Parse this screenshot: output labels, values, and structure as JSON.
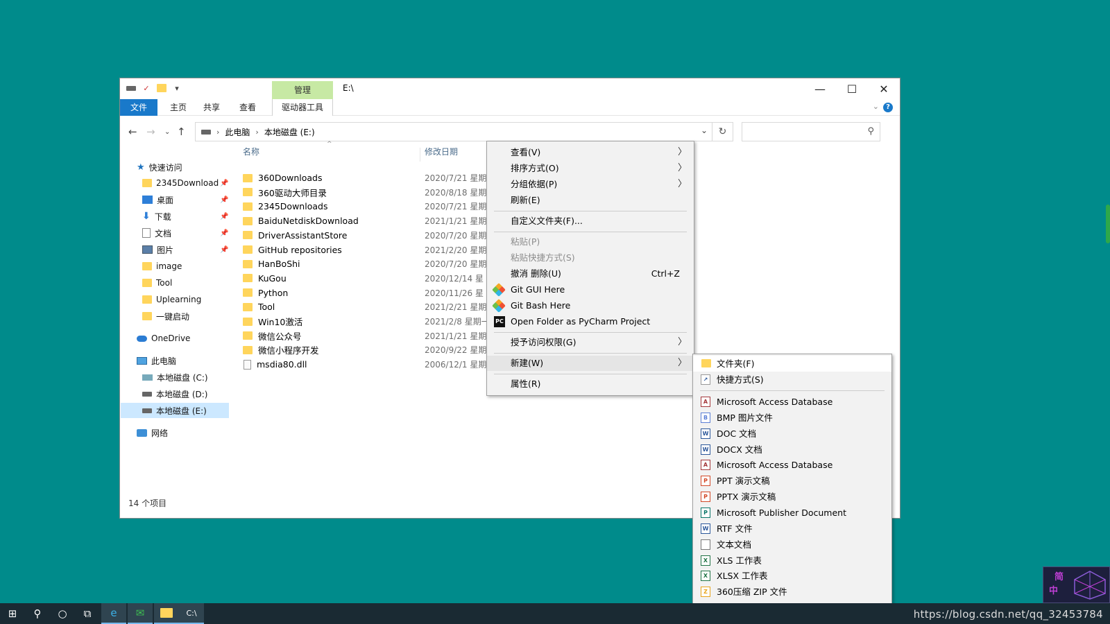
{
  "window": {
    "title": "E:\\",
    "manage_tab": "管理",
    "ribbon_tabs": [
      "文件",
      "主页",
      "共享",
      "查看",
      "驱动器工具"
    ]
  },
  "address": {
    "crumbs": [
      "此电脑",
      "本地磁盘 (E:)"
    ]
  },
  "nav": {
    "quick_access": "快速访问",
    "pinned": [
      "2345Download",
      "桌面",
      "下载",
      "文档",
      "图片"
    ],
    "folders": [
      "image",
      "Tool",
      "Uplearning",
      "一键启动"
    ],
    "onedrive": "OneDrive",
    "this_pc": "此电脑",
    "drives": [
      "本地磁盘 (C:)",
      "本地磁盘 (D:)",
      "本地磁盘 (E:)"
    ],
    "network": "网络"
  },
  "columns": {
    "name": "名称",
    "modified": "修改日期"
  },
  "files": [
    {
      "name": "360Downloads",
      "date": "2020/7/21 星期"
    },
    {
      "name": "360驱动大师目录",
      "date": "2020/8/18 星期"
    },
    {
      "name": "2345Downloads",
      "date": "2020/7/21 星期"
    },
    {
      "name": "BaiduNetdiskDownload",
      "date": "2021/1/21 星期"
    },
    {
      "name": "DriverAssistantStore",
      "date": "2020/7/20 星期"
    },
    {
      "name": "GitHub repositories",
      "date": "2021/2/20 星期"
    },
    {
      "name": "HanBoShi",
      "date": "2020/7/20 星期"
    },
    {
      "name": "KuGou",
      "date": "2020/12/14 星"
    },
    {
      "name": "Python",
      "date": "2020/11/26 星"
    },
    {
      "name": "Tool",
      "date": "2021/2/21 星期"
    },
    {
      "name": "Win10激活",
      "date": "2021/2/8 星期一"
    },
    {
      "name": "微信公众号",
      "date": "2021/1/21 星期"
    },
    {
      "name": "微信小程序开发",
      "date": "2020/9/22 星期"
    },
    {
      "name": "msdia80.dll",
      "date": "2006/12/1 星期"
    }
  ],
  "status": "14 个项目",
  "context_menu": {
    "view": "查看(V)",
    "sort": "排序方式(O)",
    "group": "分组依据(P)",
    "refresh": "刷新(E)",
    "customize": "自定义文件夹(F)...",
    "paste": "粘贴(P)",
    "paste_shortcut": "粘贴快捷方式(S)",
    "undo": "撤消 删除(U)",
    "undo_shortcut": "Ctrl+Z",
    "git_gui": "Git GUI Here",
    "git_bash": "Git Bash Here",
    "pycharm": "Open Folder as PyCharm Project",
    "grant_access": "授予访问权限(G)",
    "new": "新建(W)",
    "properties": "属性(R)"
  },
  "new_submenu": {
    "folder": "文件夹(F)",
    "shortcut": "快捷方式(S)",
    "items": [
      {
        "label": "Microsoft Access Database",
        "icon": "access-icon",
        "color": "#a4373a",
        "glyph": "A"
      },
      {
        "label": "BMP 图片文件",
        "icon": "bmp-icon",
        "color": "#5b7fd6",
        "glyph": "B"
      },
      {
        "label": "DOC 文档",
        "icon": "doc-icon",
        "color": "#2b579a",
        "glyph": "W"
      },
      {
        "label": "DOCX 文档",
        "icon": "docx-icon",
        "color": "#2b579a",
        "glyph": "W"
      },
      {
        "label": "Microsoft Access Database",
        "icon": "access-icon",
        "color": "#a4373a",
        "glyph": "A"
      },
      {
        "label": "PPT 演示文稿",
        "icon": "ppt-icon",
        "color": "#d24726",
        "glyph": "P"
      },
      {
        "label": "PPTX 演示文稿",
        "icon": "pptx-icon",
        "color": "#d24726",
        "glyph": "P"
      },
      {
        "label": "Microsoft Publisher Document",
        "icon": "publisher-icon",
        "color": "#077568",
        "glyph": "P"
      },
      {
        "label": "RTF 文件",
        "icon": "rtf-icon",
        "color": "#2b579a",
        "glyph": "W"
      },
      {
        "label": "文本文档",
        "icon": "text-icon",
        "color": "#777777",
        "glyph": ""
      },
      {
        "label": "XLS 工作表",
        "icon": "xls-icon",
        "color": "#217346",
        "glyph": "X"
      },
      {
        "label": "XLSX 工作表",
        "icon": "xlsx-icon",
        "color": "#217346",
        "glyph": "X"
      },
      {
        "label": "360压缩 ZIP 文件",
        "icon": "zip-icon",
        "color": "#e8a317",
        "glyph": "Z"
      }
    ]
  },
  "ime": {
    "top": "简",
    "bottom": "中"
  },
  "watermark": "https://blog.csdn.net/qq_32453784"
}
